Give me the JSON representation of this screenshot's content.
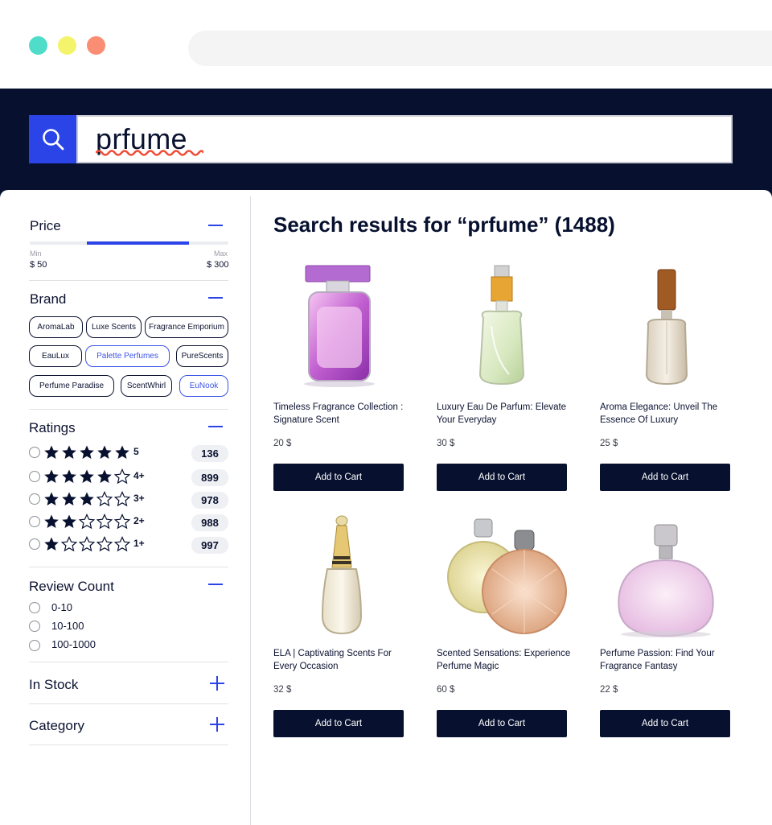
{
  "colors": {
    "dot_teal": "#4fdcc9",
    "dot_yellow": "#f4f46c",
    "dot_coral": "#f98e74",
    "header_bg": "#07112f",
    "accent": "#2b44e8",
    "squiggle": "#ef4d36"
  },
  "search": {
    "query": "prfume",
    "icon": "search-icon"
  },
  "sidebar": {
    "price": {
      "title": "Price",
      "min_label": "Min",
      "max_label": "Max",
      "min_value": "$ 50",
      "max_value": "$ 300",
      "range_fraction": [
        0.29,
        0.8
      ]
    },
    "brand": {
      "title": "Brand",
      "chips": [
        {
          "label": "AromaLab",
          "selected": false
        },
        {
          "label": "Luxe Scents",
          "selected": false
        },
        {
          "label": "Fragrance Emporium",
          "selected": false
        },
        {
          "label": "EauLux",
          "selected": false
        },
        {
          "label": "Palette Perfumes",
          "selected": true
        },
        {
          "label": "PureScents",
          "selected": false
        },
        {
          "label": "Perfume Paradise",
          "selected": false
        },
        {
          "label": "ScentWhirl",
          "selected": false
        },
        {
          "label": "EuNook",
          "selected": true
        }
      ]
    },
    "ratings": {
      "title": "Ratings",
      "rows": [
        {
          "stars": 5,
          "label": "5",
          "count": "136"
        },
        {
          "stars": 4,
          "label": "4+",
          "count": "899"
        },
        {
          "stars": 3,
          "label": "3+",
          "count": "978"
        },
        {
          "stars": 2,
          "label": "2+",
          "count": "988"
        },
        {
          "stars": 1,
          "label": "1+",
          "count": "997"
        }
      ]
    },
    "review_count": {
      "title": "Review Count",
      "options": [
        "0-10",
        "10-100",
        "100-1000"
      ]
    },
    "in_stock": {
      "title": "In Stock"
    },
    "category": {
      "title": "Category"
    }
  },
  "results": {
    "title": "Search results for  “prfume” (1488)",
    "cart_label": "Add to Cart",
    "products": [
      {
        "name": "Timeless Fragrance Collection : Signature Scent",
        "price": "20 $",
        "icon": "perfume-bottle-square-purple"
      },
      {
        "name": "Luxury Eau De Parfum: Elevate Your Everyday",
        "price": "30 $",
        "icon": "perfume-bottle-spray-green"
      },
      {
        "name": "Aroma Elegance: Unveil The Essence Of Luxury",
        "price": "25 $",
        "icon": "perfume-bottle-slim-clear"
      },
      {
        "name": "ELA | Captivating Scents For Every Occasion",
        "price": "32 $",
        "icon": "perfume-bottle-gold-cone"
      },
      {
        "name": "Scented Sensations: Experience Perfume Magic",
        "price": "60 $",
        "icon": "perfume-bottles-crystal-pair"
      },
      {
        "name": "Perfume Passion: Find Your Fragrance Fantasy",
        "price": "22 $",
        "icon": "perfume-bottle-round-pink"
      }
    ]
  }
}
